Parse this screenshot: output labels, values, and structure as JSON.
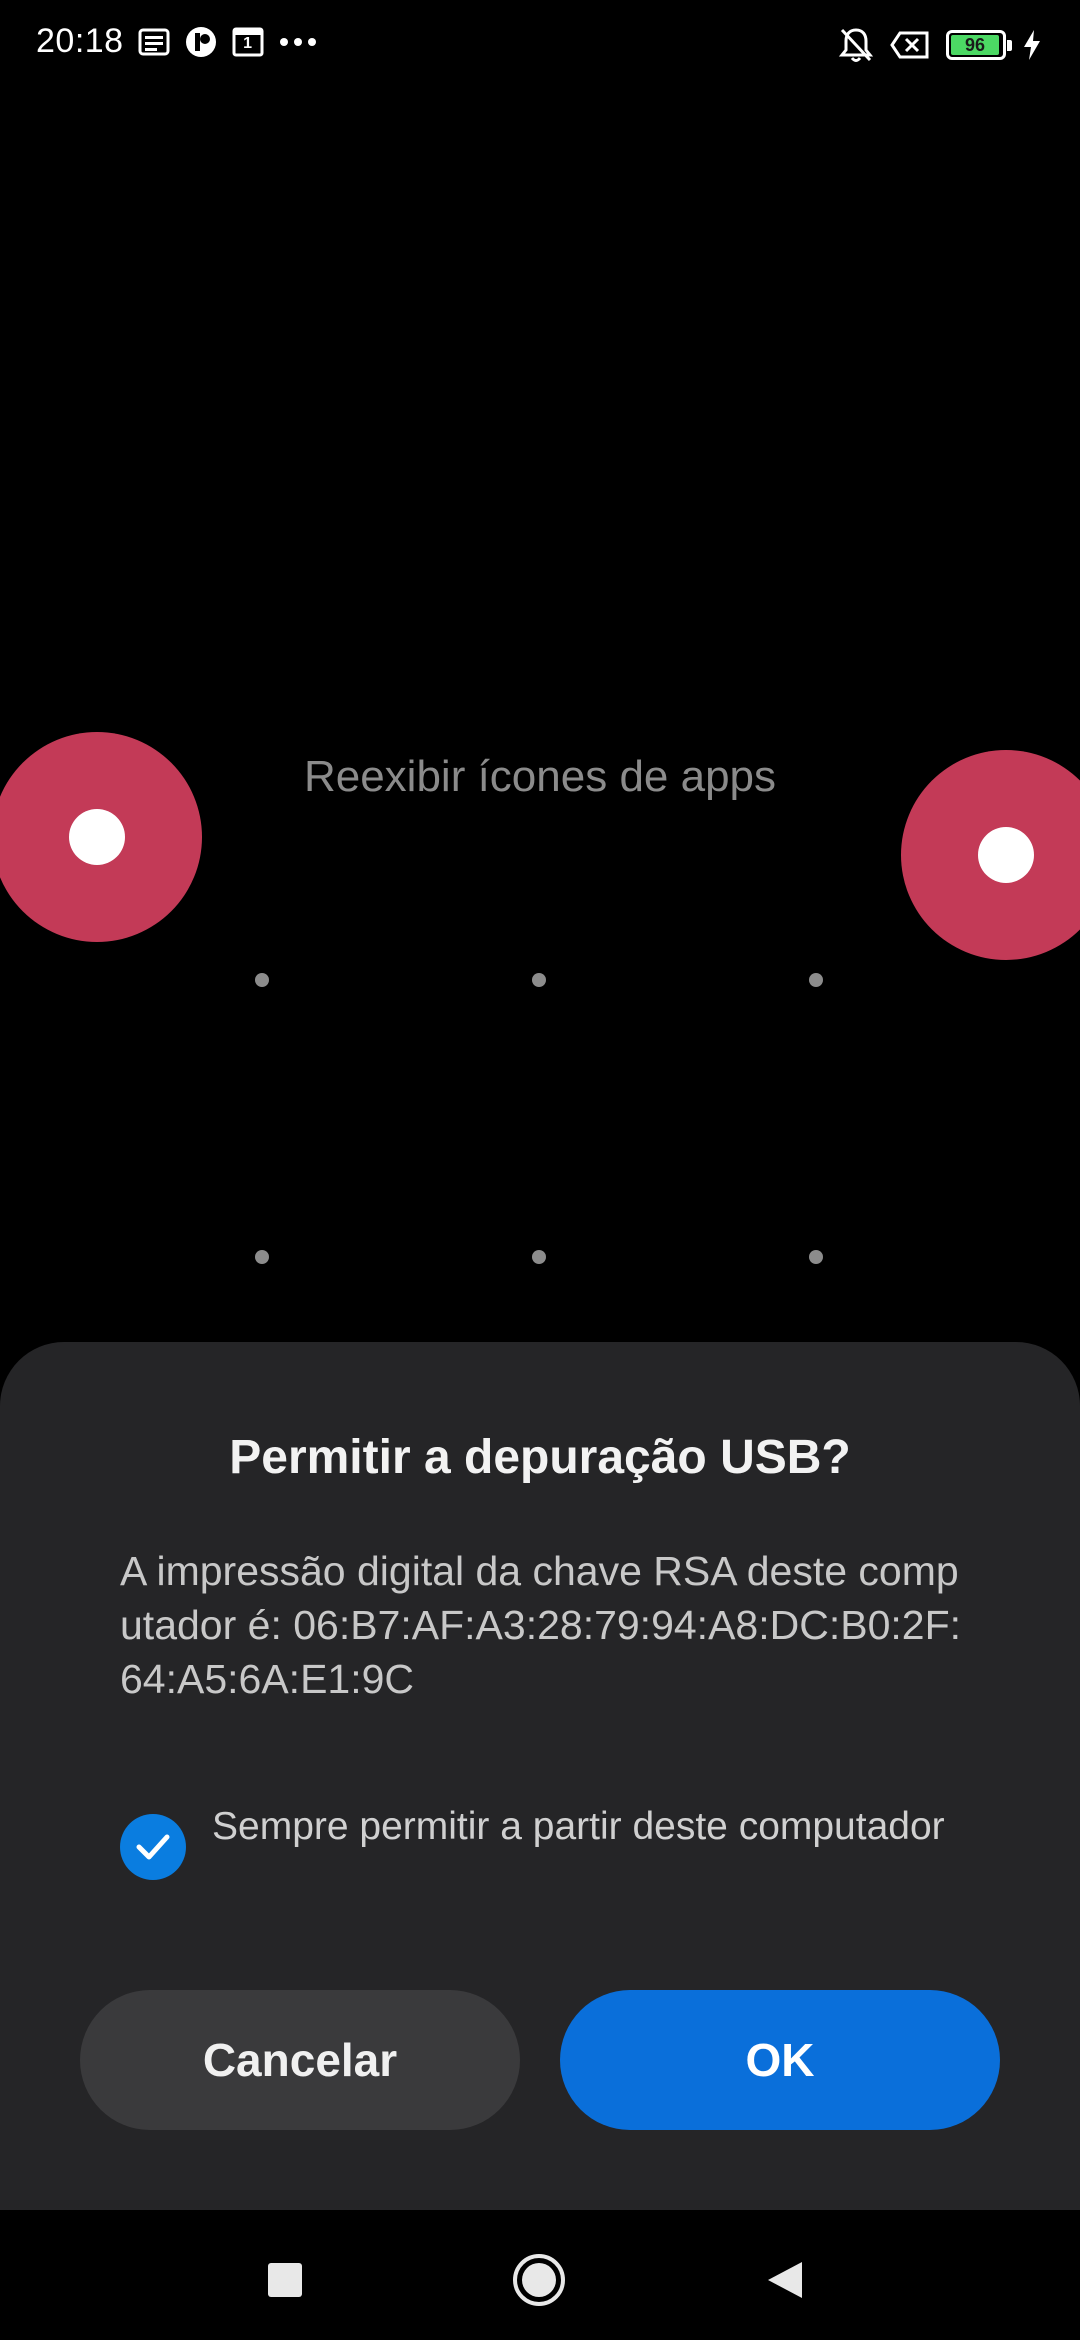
{
  "status_bar": {
    "time": "20:18",
    "notification_icons": [
      "news-icon",
      "app-icon",
      "calendar-icon",
      "more-dots-icon"
    ],
    "calendar_day": "1",
    "right_icons": [
      "silent-bell-icon",
      "no-sim-icon",
      "battery-icon",
      "charging-bolt-icon"
    ],
    "battery_level": "96",
    "battery_color": "#4cd964"
  },
  "background": {
    "hint_label": "Reexibir ícones de apps"
  },
  "dialog": {
    "title": "Permitir a depuração USB?",
    "message": "A impressão digital da chave RSA deste computador é: 06:B7:AF:A3:28:79:94:A8:DC:B0:2F:64:A5:6A:E1:9C",
    "checkbox_label": "Sempre permitir a partir deste computador",
    "checkbox_checked": true,
    "cancel_label": "Cancelar",
    "ok_label": "OK",
    "accent_color": "#0a6fda"
  },
  "nav_bar": {
    "buttons": [
      "recents-icon",
      "home-icon",
      "back-icon"
    ]
  },
  "touch_indicator_color": "#c33a57"
}
